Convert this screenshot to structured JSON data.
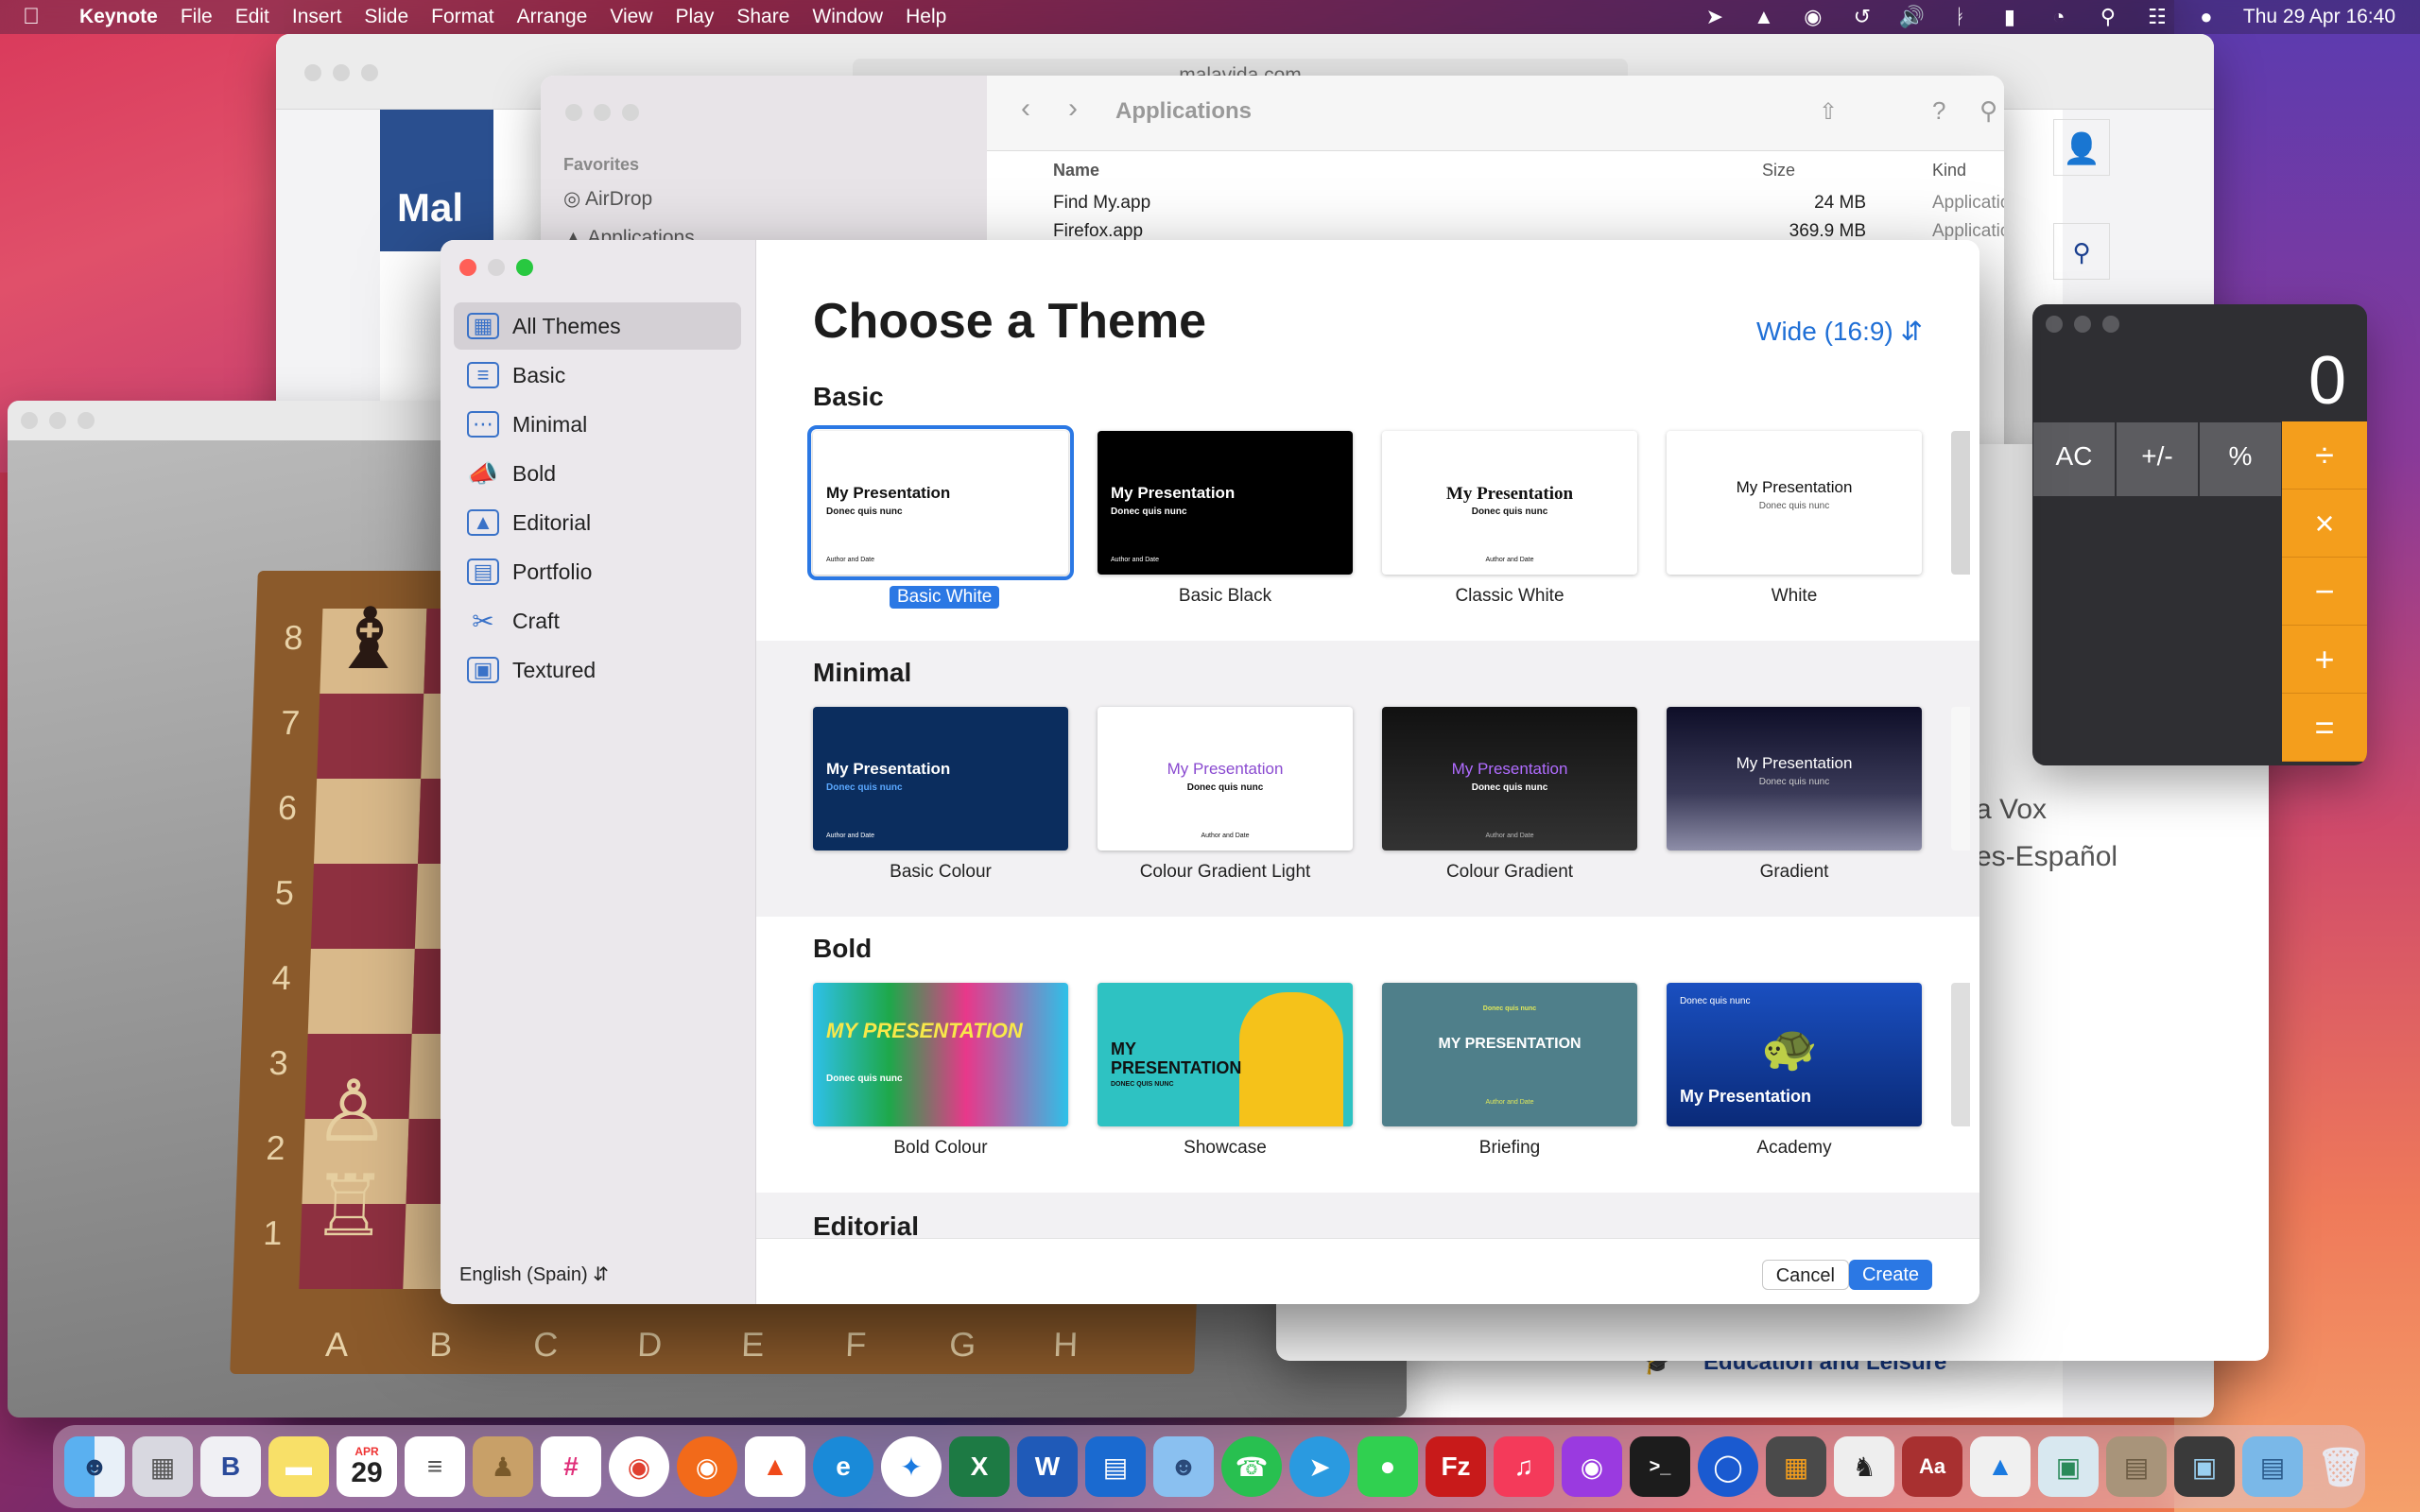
{
  "menubar": {
    "app_name": "Keynote",
    "menus": [
      "File",
      "Edit",
      "Insert",
      "Slide",
      "Format",
      "Arrange",
      "View",
      "Play",
      "Share",
      "Window",
      "Help"
    ],
    "clock": "Thu 29 Apr  16:40",
    "status_icons": [
      "location-icon",
      "adobe-icon",
      "onepassword-icon",
      "time-machine-icon",
      "volume-icon",
      "bluetooth-icon",
      "battery-icon",
      "wifi-icon",
      "spotlight-icon",
      "control-center-icon",
      "siri-icon"
    ]
  },
  "safari": {
    "url": "malavida.com",
    "brand_text": "Mal",
    "education_link": "Education and Leisure"
  },
  "chess": {
    "ranks": [
      "8",
      "7",
      "6",
      "5",
      "4",
      "3",
      "2",
      "1"
    ],
    "files": [
      "A",
      "B",
      "C",
      "D",
      "E",
      "F",
      "G",
      "H"
    ]
  },
  "finder": {
    "title": "Applications",
    "sidebar_section": "Favorites",
    "sidebar_items": [
      "AirDrop",
      "Applications"
    ],
    "columns": {
      "name": "Name",
      "size": "Size",
      "kind": "Kind"
    },
    "rows": [
      {
        "name": "Find My.app",
        "size": "24 MB",
        "kind": "Application"
      },
      {
        "name": "Firefox.app",
        "size": "369.9 MB",
        "kind": "Application"
      }
    ],
    "kind_fragment": "ion"
  },
  "calculator": {
    "display": "0",
    "keys": [
      "AC",
      "+/-",
      "%"
    ],
    "operators": [
      "÷",
      "×",
      "−",
      "+",
      "="
    ]
  },
  "dictionary": {
    "line1": "a Vox",
    "line2": "es-Español"
  },
  "chooser": {
    "heading": "Choose a Theme",
    "aspect": "Wide (16:9)",
    "language": "English (Spain)",
    "categories": [
      {
        "label": "All Themes",
        "icon": "all-themes-icon"
      },
      {
        "label": "Basic",
        "icon": "basic-icon"
      },
      {
        "label": "Minimal",
        "icon": "minimal-icon"
      },
      {
        "label": "Bold",
        "icon": "bold-icon"
      },
      {
        "label": "Editorial",
        "icon": "editorial-icon"
      },
      {
        "label": "Portfolio",
        "icon": "portfolio-icon"
      },
      {
        "label": "Craft",
        "icon": "craft-icon"
      },
      {
        "label": "Textured",
        "icon": "textured-icon"
      }
    ],
    "sections": {
      "basic": {
        "title": "Basic",
        "themes": [
          {
            "name": "Basic White",
            "slide_title": "My Presentation",
            "slide_sub": "Donec quis nunc",
            "slide_author": "Author and Date"
          },
          {
            "name": "Basic Black",
            "slide_title": "My Presentation",
            "slide_sub": "Donec quis nunc",
            "slide_author": "Author and Date"
          },
          {
            "name": "Classic White",
            "slide_title": "My Presentation",
            "slide_sub": "Donec quis nunc",
            "slide_author": "Author and Date"
          },
          {
            "name": "White",
            "slide_title": "My Presentation",
            "slide_sub": "Donec quis nunc",
            "slide_author": ""
          }
        ]
      },
      "minimal": {
        "title": "Minimal",
        "themes": [
          {
            "name": "Basic Colour",
            "slide_title": "My Presentation",
            "slide_sub": "Donec quis nunc",
            "slide_author": "Author and Date"
          },
          {
            "name": "Colour Gradient Light",
            "slide_title": "My Presentation",
            "slide_sub": "Donec quis nunc",
            "slide_author": "Author and Date"
          },
          {
            "name": "Colour Gradient",
            "slide_title": "My Presentation",
            "slide_sub": "Donec quis nunc",
            "slide_author": "Author and Date"
          },
          {
            "name": "Gradient",
            "slide_title": "My Presentation",
            "slide_sub": "Donec quis nunc",
            "slide_author": ""
          }
        ]
      },
      "bold": {
        "title": "Bold",
        "themes": [
          {
            "name": "Bold Colour",
            "slide_title": "MY PRESENTATION",
            "slide_sub": "Donec quis nunc",
            "slide_author": ""
          },
          {
            "name": "Showcase",
            "slide_title": "MY PRESENTATION",
            "slide_sub": "DONEC QUIS NUNC",
            "slide_author": ""
          },
          {
            "name": "Briefing",
            "slide_title": "MY PRESENTATION",
            "slide_sub": "Donec quis nunc",
            "slide_author": "Author and Date"
          },
          {
            "name": "Academy",
            "slide_title": "My Presentation",
            "slide_sub": "Donec quis nunc",
            "slide_author": ""
          }
        ]
      },
      "editorial": {
        "title": "Editorial"
      }
    },
    "buttons": {
      "cancel": "Cancel",
      "create": "Create"
    }
  },
  "colors": {
    "accent": "#2b78e4",
    "calculator_orange": "#f49e1c",
    "close_red": "#ff5f57",
    "zoom_green": "#28c840"
  },
  "dock": {
    "calendar_month": "APR",
    "calendar_day": "29",
    "apps": [
      "finder-icon",
      "launchpad-icon",
      "bbedit-icon",
      "notes-icon",
      "calendar-icon",
      "reminders-icon",
      "contacts-icon",
      "slack-icon",
      "chrome-icon",
      "firefox-icon",
      "brave-icon",
      "edge-icon",
      "safari-icon",
      "excel-icon",
      "word-icon",
      "trello-icon",
      "tweetbot-icon",
      "whatsapp-icon",
      "telegram-icon",
      "messages-icon",
      "filezilla-icon",
      "music-icon",
      "podcasts-icon",
      "terminal-icon",
      "onepassword-icon",
      "calculator-icon",
      "chess-icon",
      "dictionary-icon",
      "keynote-icon",
      "preview-icon",
      "archive-icon",
      "screen-capture-icon",
      "downloads-folder-icon",
      "trash-icon"
    ]
  }
}
